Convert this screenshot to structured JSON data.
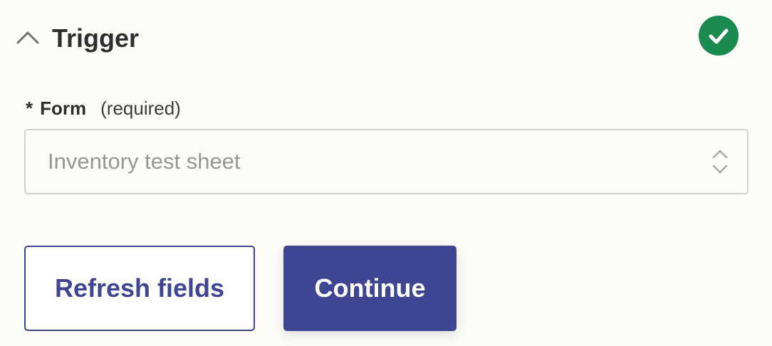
{
  "section": {
    "title": "Trigger",
    "collapse_icon": "chevron-up-icon",
    "status_icon": "check-circle-icon",
    "status_color": "#1b8a4f"
  },
  "form_field": {
    "asterisk": "*",
    "label": "Form",
    "required_text": "(required)",
    "selected_value": "Inventory test sheet",
    "arrows_icon": "select-arrows-icon"
  },
  "buttons": {
    "refresh_label": "Refresh fields",
    "continue_label": "Continue",
    "accent_color": "#3e4593"
  }
}
